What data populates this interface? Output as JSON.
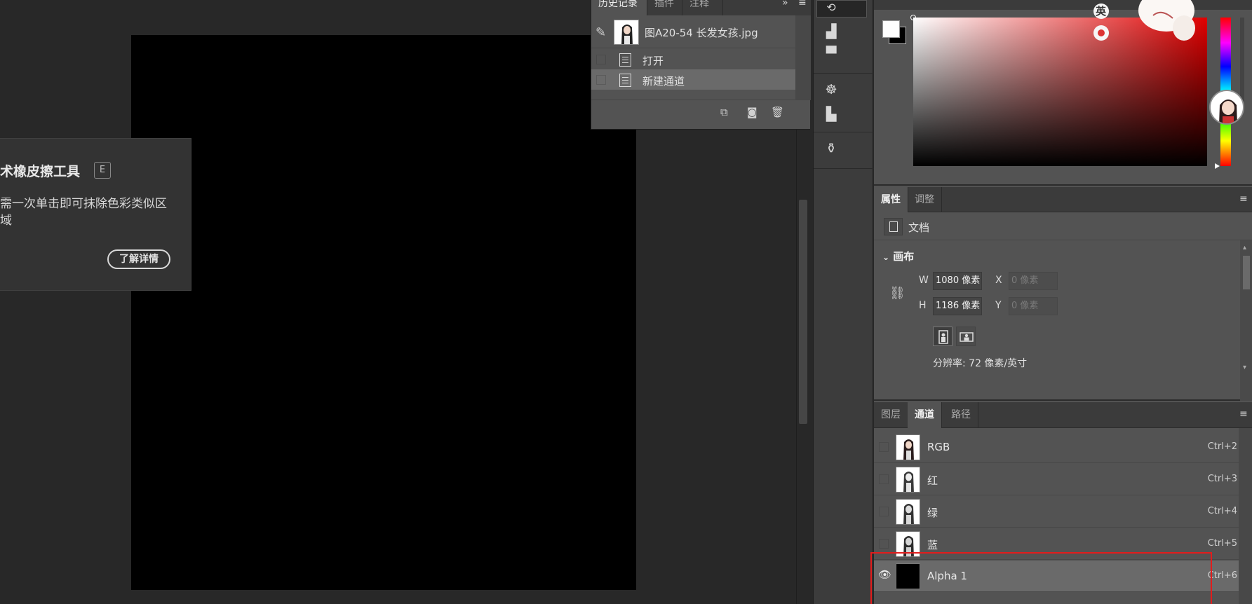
{
  "history": {
    "tabs": [
      "历史记录",
      "插件",
      "注释"
    ],
    "snapshot_label": "图A20-54 长发女孩.jpg",
    "items": [
      "打开",
      "新建通道"
    ],
    "footer_icons": [
      "new-doc-from-state-icon",
      "camera-icon",
      "trash-icon"
    ]
  },
  "tooltip": {
    "title": "术橡皮擦工具",
    "shortcut": "E",
    "description": "需一次单击即可抹除色彩类似区域",
    "button": "了解详情"
  },
  "color_panel": {
    "foreground": "#ffffff",
    "background": "#000000",
    "hue": "#e00000",
    "sticker_text": "英"
  },
  "properties": {
    "tabs": [
      "属性",
      "调整"
    ],
    "doc_label": "文档",
    "section_title": "画布",
    "width_label": "W",
    "width_value": "1080 像素",
    "height_label": "H",
    "height_value": "1186 像素",
    "x_label": "X",
    "x_placeholder": "0 像素",
    "y_label": "Y",
    "y_placeholder": "0 像素",
    "resolution": "分辨率: 72 像素/英寸"
  },
  "channels": {
    "tabs": [
      "图层",
      "通道",
      "路径"
    ],
    "rows": [
      {
        "name": "RGB",
        "shortcut": "Ctrl+2"
      },
      {
        "name": "红",
        "shortcut": "Ctrl+3"
      },
      {
        "name": "绿",
        "shortcut": "Ctrl+4"
      },
      {
        "name": "蓝",
        "shortcut": "Ctrl+5"
      },
      {
        "name": "Alpha 1",
        "shortcut": "Ctrl+6"
      }
    ]
  },
  "accent": {
    "highlight": "#e21c1c",
    "canvas": "#000000"
  }
}
